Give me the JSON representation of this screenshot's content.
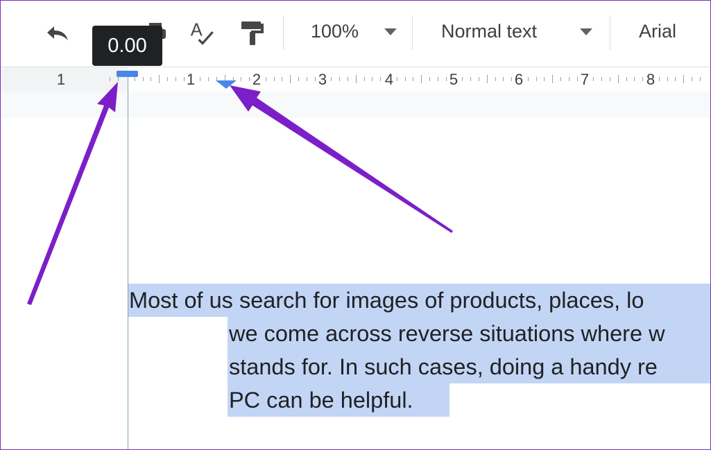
{
  "toolbar": {
    "undo_icon": "undo-icon",
    "redo_icon": "redo-icon",
    "print_icon": "print-icon",
    "spellcheck_icon": "spellcheck-icon",
    "paint_format_icon": "paint-format-icon",
    "zoom_value": "100%",
    "style_value": "Normal text",
    "font_value": "Arial"
  },
  "tooltip": {
    "text": "0.00"
  },
  "ruler": {
    "labels": [
      "1",
      "1",
      "2",
      "3",
      "4",
      "5",
      "6",
      "7",
      "8"
    ],
    "indent_color": "#4a86e8"
  },
  "document": {
    "lines": [
      "Most of us search for images of products, places, lo",
      "we come across reverse situations where w",
      "stands for. In such cases, doing a handy re",
      "PC can be helpful."
    ],
    "selection_color": "#c2d5f5"
  },
  "annotation": {
    "arrow_color": "#7b1fc9"
  }
}
